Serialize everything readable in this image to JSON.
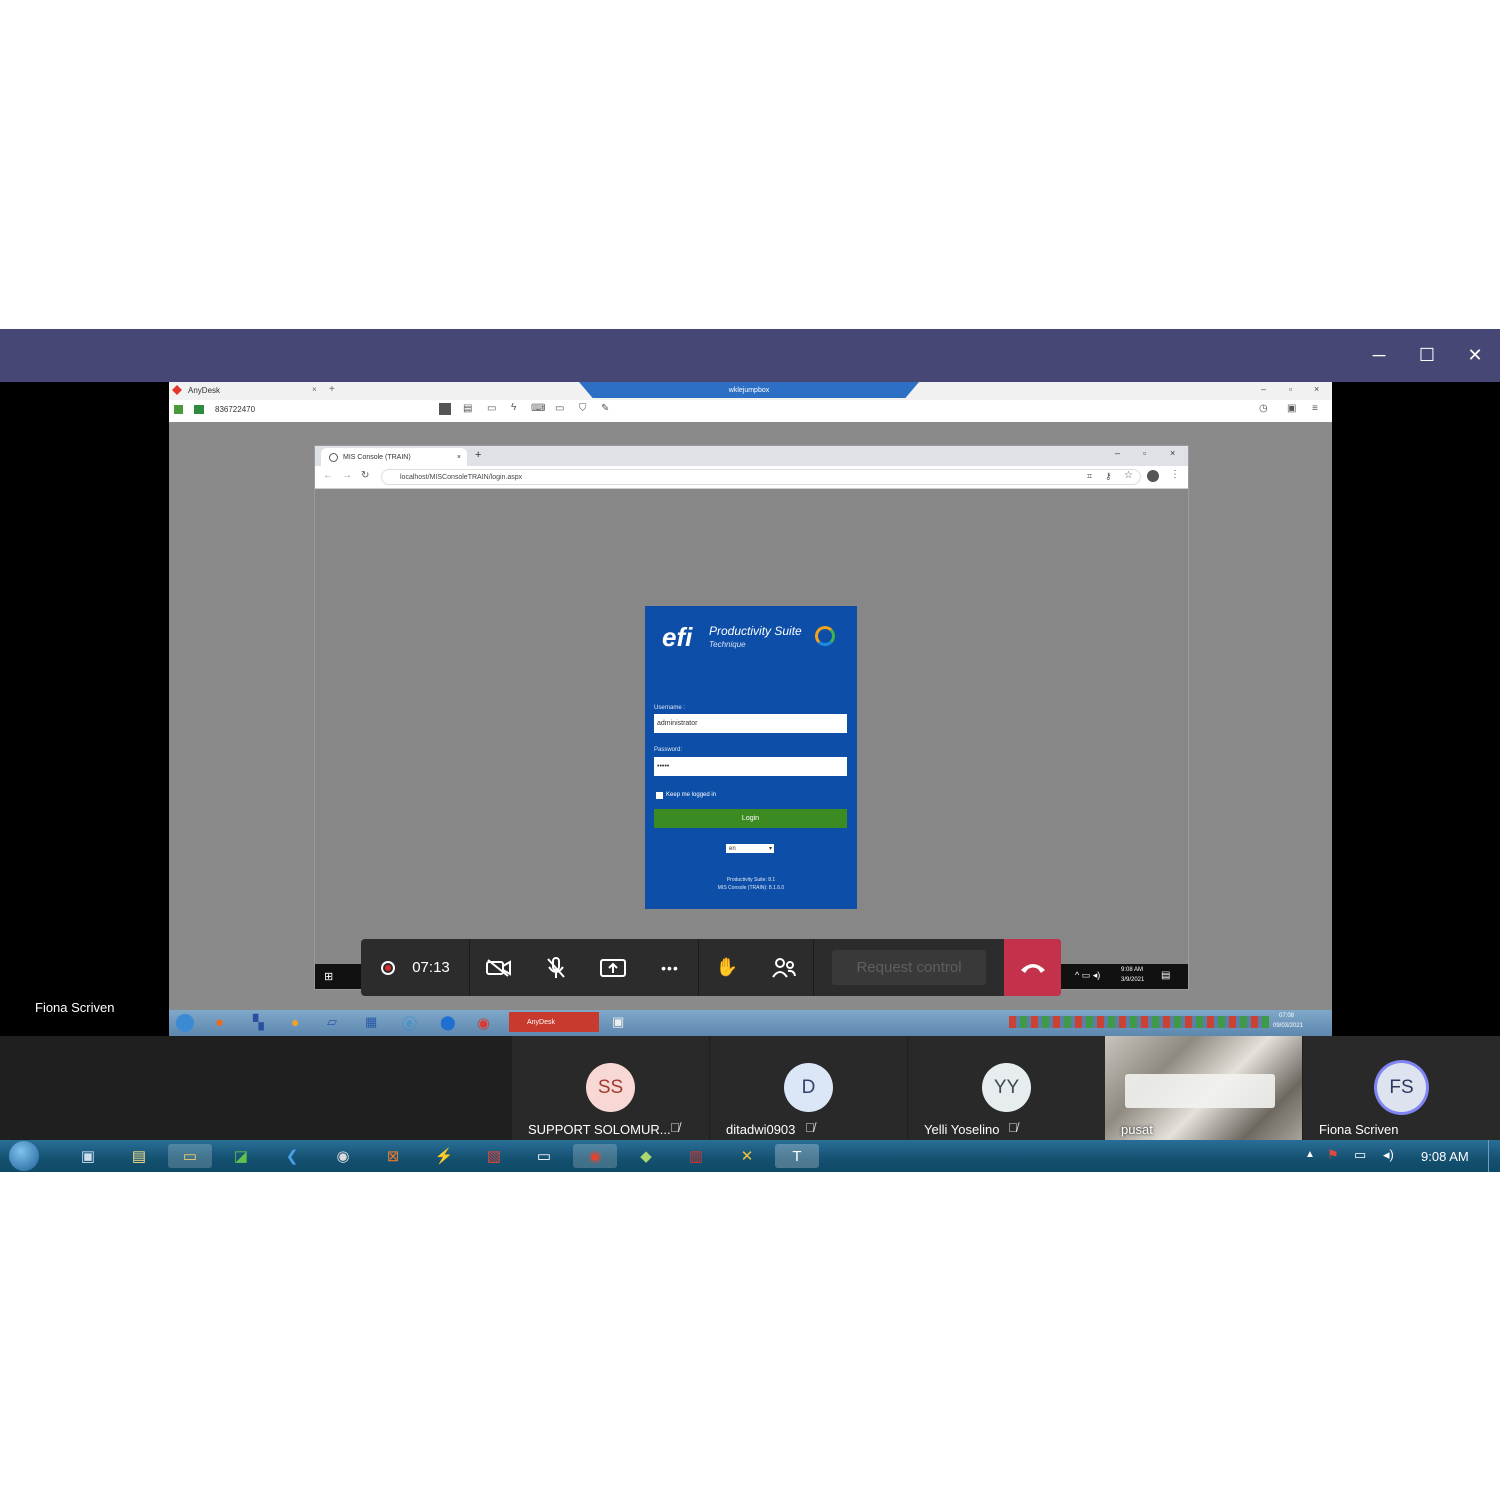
{
  "window": {
    "controls": {
      "minimize": "─",
      "maximize": "☐",
      "close": "✕"
    }
  },
  "anydesk": {
    "app_name": "AnyDesk",
    "session_id": "836722470",
    "banner_title": "wklejumpbox"
  },
  "chrome": {
    "tab_title": "MIS Console (TRAIN)",
    "url": "localhost/MISConsoleTRAIN/login.aspx"
  },
  "login": {
    "brand": "efi",
    "product": "Productivity Suite",
    "edition": "Technique",
    "username_label": "Username :",
    "username_value": "administrator",
    "password_label": "Password:",
    "password_value": "•••••",
    "keep_logged_in": "Keep me logged in",
    "login_button": "Login",
    "language": "en",
    "version_line1": "Productivity Suite: 8.1",
    "version_line2": "MIS Console (TRAIN): 8.1.6.0"
  },
  "remote_taskbar": {
    "time": "9:08 AM",
    "date": "3/9/2021"
  },
  "anydesk_host_bar": {
    "time": "07:08",
    "date": "09/03/2021"
  },
  "presenter_name": "Fiona Scriven",
  "call_controls": {
    "timer": "07:13",
    "request_control": "Request control",
    "more": "•••"
  },
  "participants": [
    {
      "initials": "SS",
      "name": "SUPPORT SOLOMUR...",
      "avatar_bg": "#f7d8d4",
      "avatar_fg": "#a23b2f",
      "muted": true
    },
    {
      "initials": "D",
      "name": "ditadwi0903",
      "avatar_bg": "#dbe6f7",
      "avatar_fg": "#33416e",
      "muted": true
    },
    {
      "initials": "YY",
      "name": "Yelli Yoselino",
      "avatar_bg": "#e7ecef",
      "avatar_fg": "#3d4a52",
      "muted": true
    },
    {
      "initials": "",
      "name": "pusat",
      "avatar_bg": "",
      "avatar_fg": "",
      "muted": false
    },
    {
      "initials": "FS",
      "name": "Fiona Scriven",
      "avatar_bg": "#dde3ef",
      "avatar_fg": "#2c3a5e",
      "muted": false
    }
  ],
  "taskbar": {
    "time": "9:08 AM"
  },
  "colors": {
    "teams_titlebar": "#464775",
    "hangup": "#c4314b",
    "efi_blue": "#0d4fa8",
    "login_green": "#3c8b22"
  }
}
